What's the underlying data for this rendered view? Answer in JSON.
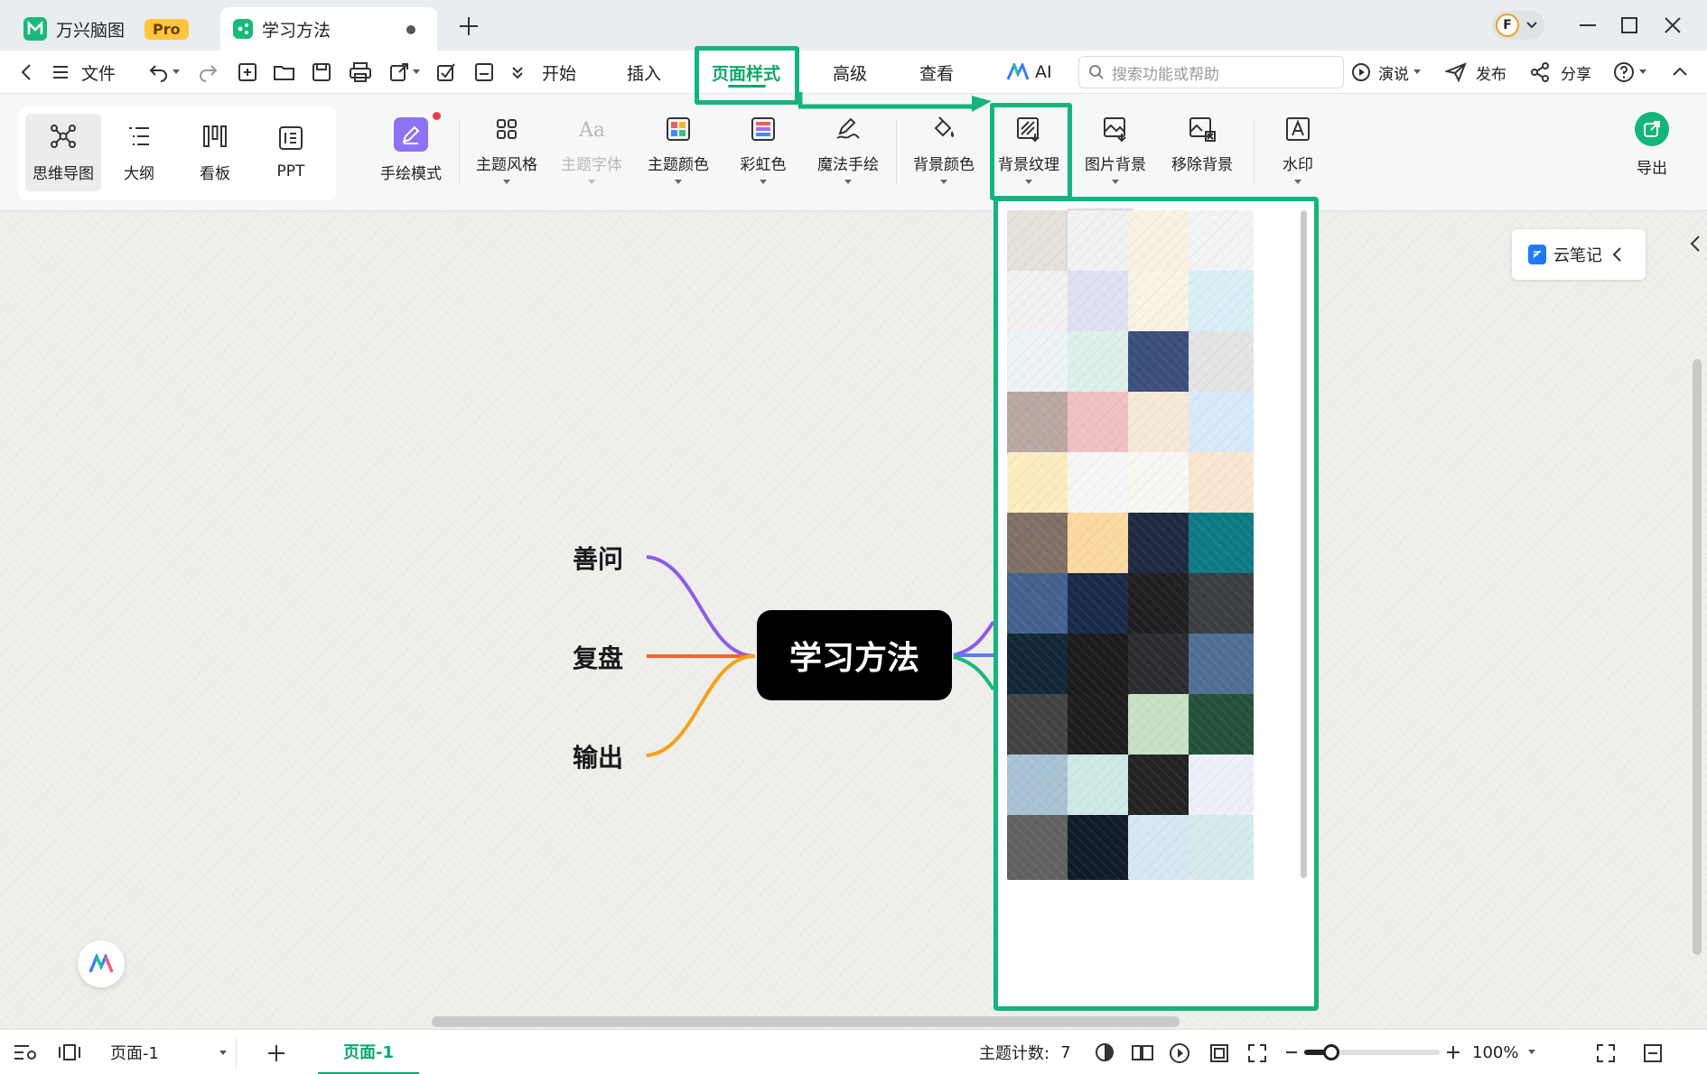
{
  "window": {
    "tabs": [
      {
        "label": "万兴脑图",
        "badge": "Pro"
      },
      {
        "label": "学习方法"
      }
    ]
  },
  "menu": {
    "file": "文件",
    "items": [
      "开始",
      "插入",
      "页面样式",
      "高级",
      "查看",
      "AI"
    ],
    "active": "页面样式",
    "search_placeholder": "搜索功能或帮助",
    "present": "演说",
    "publish": "发布",
    "share": "分享"
  },
  "ribbon": {
    "views": [
      "思维导图",
      "大纲",
      "看板",
      "PPT"
    ],
    "buttons": {
      "handdraw": "手绘模式",
      "theme_style": "主题风格",
      "theme_font": "主题字体",
      "theme_color": "主题颜色",
      "rainbow": "彩虹色",
      "magic_draw": "魔法手绘",
      "bg_color": "背景颜色",
      "bg_texture": "背景纹理",
      "image_bg": "图片背景",
      "remove_bg": "移除背景",
      "watermark": "水印",
      "export": "导出"
    }
  },
  "mindmap": {
    "root": "学习方法",
    "branches": [
      "善问",
      "复盘",
      "输出"
    ],
    "branch_colors": [
      "#8c5ce8",
      "#f2652b",
      "#f5a218"
    ]
  },
  "cloud_note": "云笔记",
  "textures": [
    "#e6e1da",
    "#f1f1f1",
    "#f7f2e1",
    "#f3f3f3",
    "#f1f1f1",
    "#dde1f1",
    "#f8f3e3",
    "#d9eef7",
    "#eef3f8",
    "#dcf1ea",
    "#3b4e7c",
    "#e4e4e4",
    "#b9a7a2",
    "#f0c1c4",
    "#f6e9d7",
    "#d8e9f9",
    "#fcecc1",
    "#f6f6f6",
    "#f7f8f2",
    "#f9e7d1",
    "#7f7065",
    "#fbd9a0",
    "#1f2940",
    "#0e7a84",
    "#43618e",
    "#192a48",
    "#202020",
    "#3a3d42",
    "#122636",
    "#1c1c1c",
    "#2a2c30",
    "#4e6f93",
    "#434345",
    "#1d1d1d",
    "#c6e1c7",
    "#24513a",
    "#a7c2d2",
    "#cfe9e6",
    "#232323",
    "#edeff9",
    "#616161",
    "#111a2a",
    "#d7e8f3",
    "#d6ebeb"
  ],
  "status": {
    "page_select": "页面-1",
    "page_tab": "页面-1",
    "topic_count_label": "主题计数:",
    "topic_count": "7",
    "zoom": "100%"
  }
}
